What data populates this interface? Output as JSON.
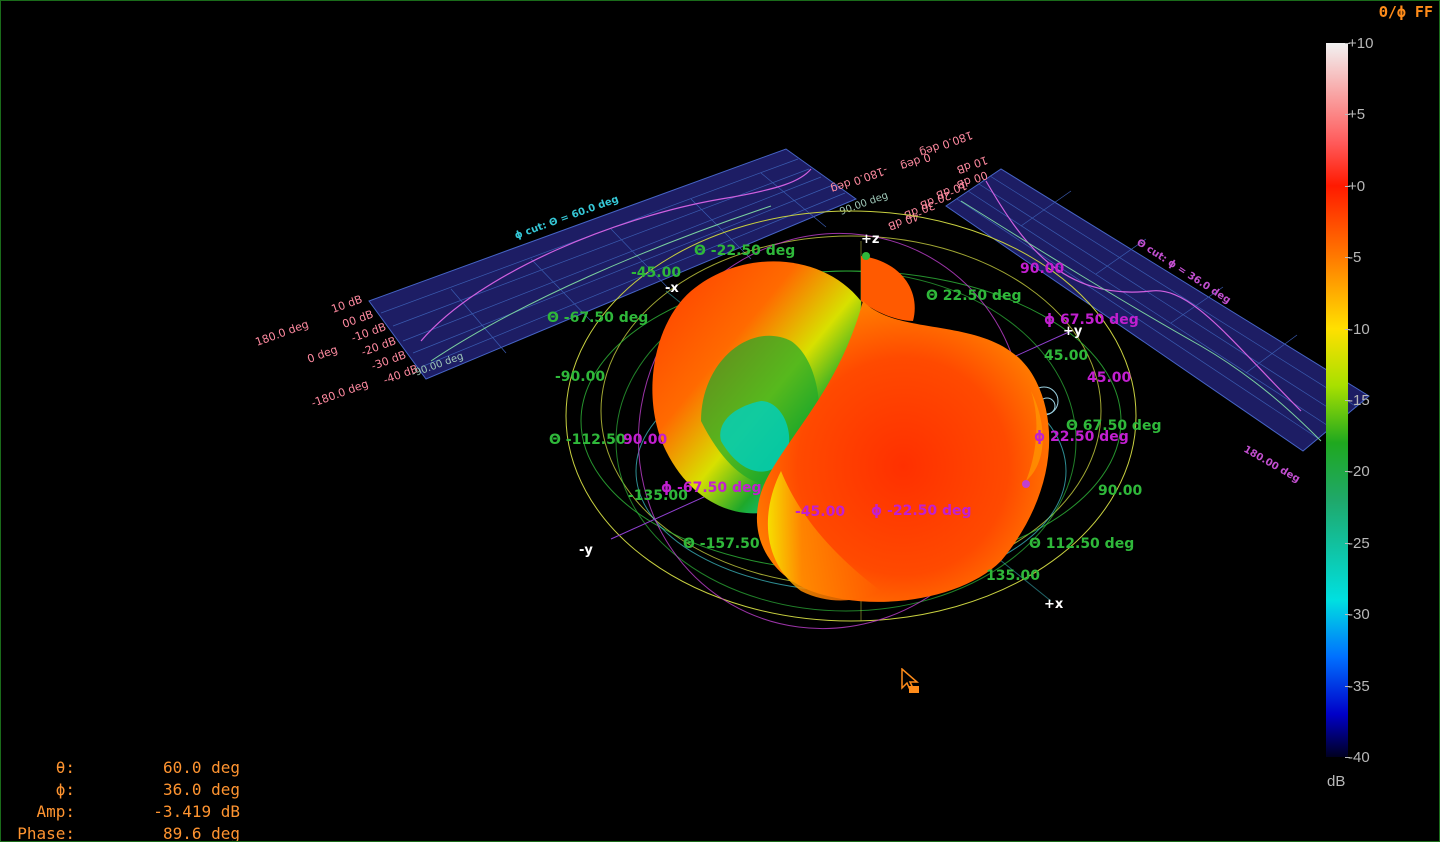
{
  "mode_label": "Θ/ϕ FF",
  "colorbar": {
    "unit": "dB",
    "ticks": [
      "+10",
      "+5",
      "+0",
      "-5",
      "-10",
      "-15",
      "-20",
      "-25",
      "-30",
      "-35",
      "-40"
    ]
  },
  "readout": {
    "theta_label": "θ:",
    "theta_value": "60.0 deg",
    "phi_label": "ϕ:",
    "phi_value": "36.0 deg",
    "amp_label": "Amp:",
    "amp_value": "-3.419 dB",
    "phase_label": "Phase:",
    "phase_value": "89.6 deg"
  },
  "axes": {
    "plus_z": "+z",
    "plus_y": "+y",
    "minus_y": "-y",
    "plus_x": "+x",
    "minus_x": "-x"
  },
  "theta_labels": [
    "Θ -22.50 deg",
    "Θ 22.50 deg",
    "Θ -67.50 deg",
    "Θ 67.50 deg",
    "Θ -112.50",
    "Θ 112.50 deg",
    "Θ -157.50"
  ],
  "phi_labels": [
    "ϕ 67.50 deg",
    "ϕ 22.50 deg",
    "ϕ -67.50 deg",
    "ϕ -22.50 deg"
  ],
  "angle_labels_green": [
    "-45.00",
    "45.00",
    "-90.00",
    "90.00",
    "-135.00",
    "135.00"
  ],
  "angle_labels_magenta": [
    "90.00",
    "45.00",
    "90.00",
    "-45.00"
  ],
  "phi_cut": {
    "title": "ϕ cut: Θ = 60.0 deg",
    "db_ticks": [
      "10 dB",
      "00 dB",
      "-10 dB",
      "-20 dB",
      "-30 dB",
      "-40 dB"
    ],
    "x_start": "-90.00 deg",
    "x_end": "90.00 deg",
    "phase_ticks": [
      "180.0 deg",
      "0 deg",
      "-180.0 deg"
    ]
  },
  "theta_cut": {
    "title": "Θ cut: ϕ = 36.0 deg",
    "db_ticks": [
      "10 dB",
      "00 dB",
      "-10 dB",
      "-20 dB",
      "-30 dB",
      "-40 dB"
    ],
    "x_end": "180.00 deg",
    "phase_ticks": [
      "180.0 deg",
      "0 deg",
      "-180.0 deg"
    ]
  }
}
